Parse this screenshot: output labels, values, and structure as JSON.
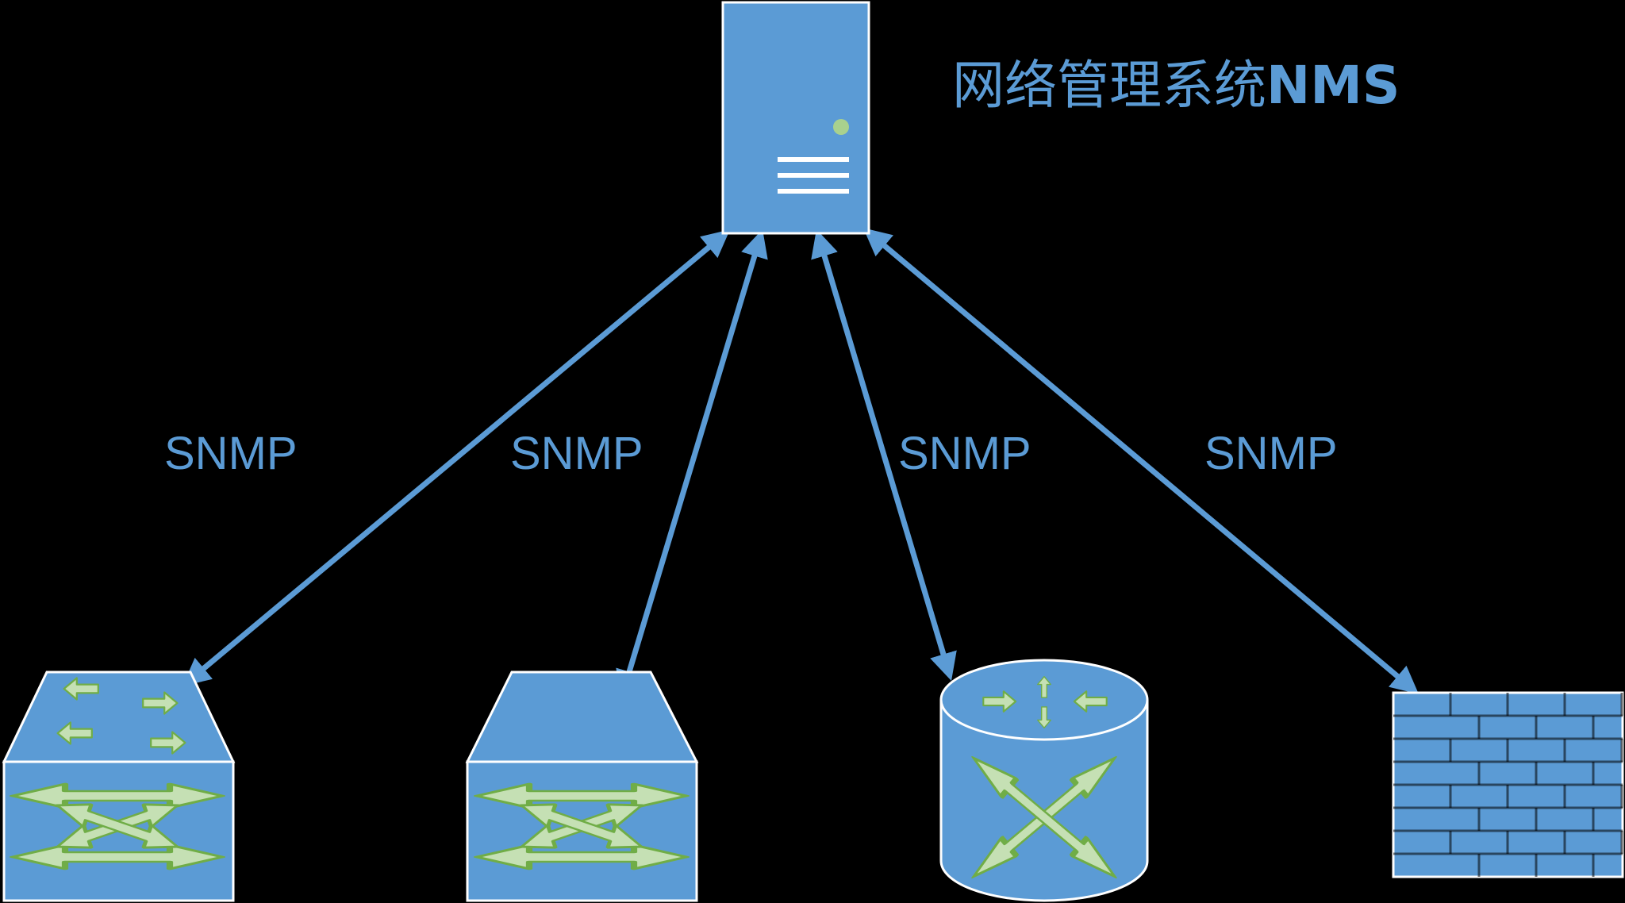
{
  "title": {
    "main": "网络管理系统",
    "suffix": "NMS"
  },
  "links": [
    {
      "label": "SNMP",
      "target": "switch-left"
    },
    {
      "label": "SNMP",
      "target": "switch-middle"
    },
    {
      "label": "SNMP",
      "target": "router"
    },
    {
      "label": "SNMP",
      "target": "firewall"
    }
  ],
  "colors": {
    "background": "#000000",
    "device_fill": "#5b9bd5",
    "line": "#5b9bd5",
    "indicator": "#a9d18e",
    "arrow_fill": "#c5e0b4",
    "arrow_stroke": "#70ad47"
  },
  "icons": {
    "server": "server-icon",
    "switch_left": "multilayer-switch-icon",
    "switch_middle": "switch-icon",
    "router": "router-icon",
    "firewall": "firewall-icon"
  }
}
